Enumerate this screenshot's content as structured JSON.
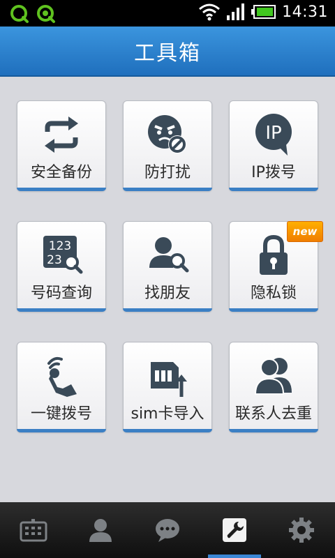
{
  "status": {
    "time": "14:31",
    "left_icons": [
      "qq-icon",
      "qq-browser-icon"
    ],
    "right_icons": [
      "wifi-icon",
      "signal-icon",
      "battery-icon"
    ]
  },
  "header": {
    "title": "工具箱"
  },
  "tools": [
    {
      "label": "安全备份",
      "icon": "sync-icon"
    },
    {
      "label": "防打扰",
      "icon": "block-face-icon"
    },
    {
      "label": "IP拨号",
      "icon": "ip-bubble-icon"
    },
    {
      "label": "号码查询",
      "icon": "number-search-icon"
    },
    {
      "label": "找朋友",
      "icon": "person-search-icon"
    },
    {
      "label": "隐私锁",
      "icon": "lock-icon",
      "badge": "new"
    },
    {
      "label": "一键拨号",
      "icon": "touch-dial-icon"
    },
    {
      "label": "sim卡导入",
      "icon": "sim-import-icon"
    },
    {
      "label": "联系人去重",
      "icon": "contacts-dedupe-icon"
    }
  ],
  "bottom_nav": [
    {
      "icon": "keypad-icon",
      "active": false
    },
    {
      "icon": "contact-icon",
      "active": false
    },
    {
      "icon": "message-icon",
      "active": false
    },
    {
      "icon": "toolbox-icon",
      "active": true
    },
    {
      "icon": "settings-icon",
      "active": false
    }
  ],
  "colors": {
    "header_blue": "#2a7fcd",
    "accent_blue": "#3b7fc4",
    "icon_dark": "#3a4a58",
    "badge_orange": "#f59300",
    "background": "#d7d8dd"
  }
}
